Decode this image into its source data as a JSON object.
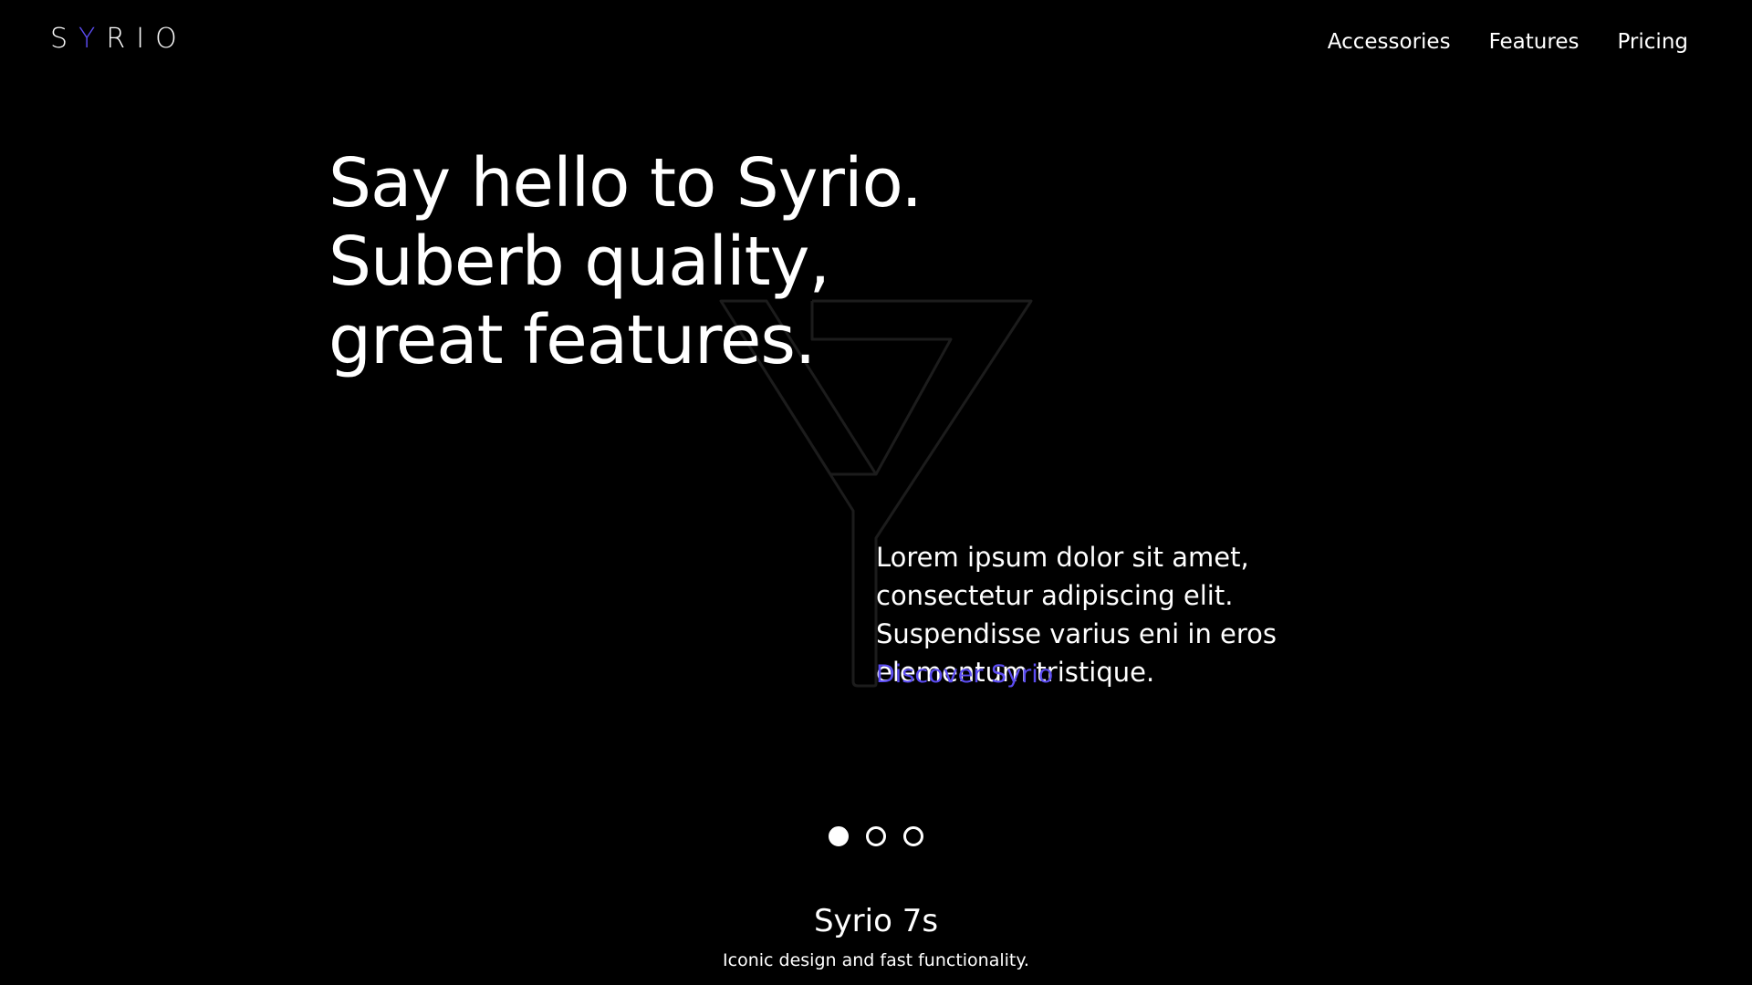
{
  "brand": {
    "logo_text_1": "S",
    "logo_text_accent": "Y",
    "logo_text_2": "RIO",
    "accent_color": "#5b4cf0"
  },
  "nav": {
    "items": [
      {
        "label": "Accessories"
      },
      {
        "label": "Features"
      },
      {
        "label": "Pricing"
      }
    ]
  },
  "hero": {
    "title_lines": [
      "Say hello to Syrio.",
      "Suberb quality,",
      "great features."
    ],
    "description": "Lorem ipsum dolor sit amet, consectetur adipiscing elit. Suspendisse varius eni in eros elementum tristique.",
    "cta_label": "Discover Syrio",
    "background_icon": "y-outline-icon"
  },
  "carousel": {
    "active_index": 0,
    "count": 3
  },
  "product": {
    "name": "Syrio 7s",
    "tagline": "Iconic design and fast functionality."
  }
}
